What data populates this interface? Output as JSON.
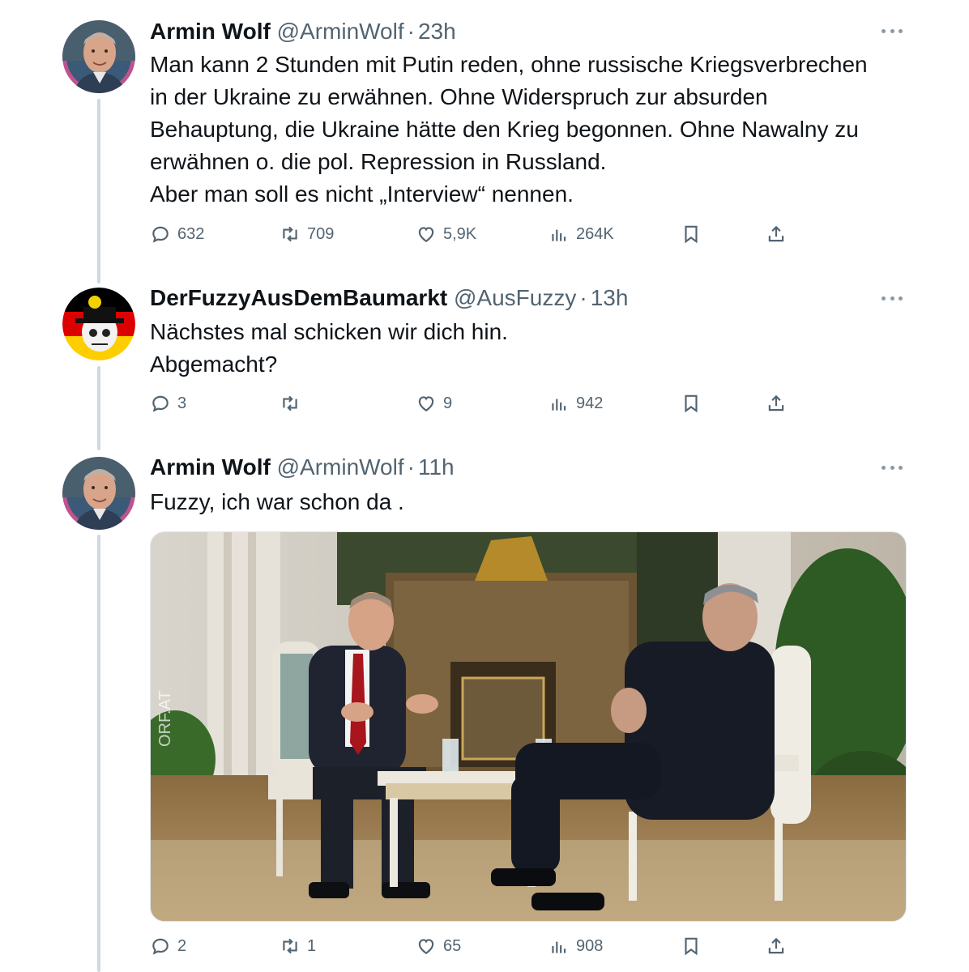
{
  "tweets": [
    {
      "name": "Armin Wolf",
      "handle": "@ArminWolf",
      "time": "23h",
      "lines": [
        "Man kann 2 Stunden mit Putin reden, ohne russische Kriegsverbrechen",
        "in der Ukraine zu erwähnen. Ohne Widerspruch zur absurden",
        "Behauptung, die Ukraine hätte den Krieg begonnen. Ohne Nawalny zu",
        "erwähnen o. die pol. Repression in Russland.",
        "Aber man soll es nicht „Interview“ nennen."
      ],
      "replies": "632",
      "retweets": "709",
      "likes": "5,9K",
      "views": "264K"
    },
    {
      "name": "DerFuzzyAusDemBaumarkt",
      "handle": "@AusFuzzy",
      "time": "13h",
      "lines": [
        "Nächstes mal schicken wir dich hin.",
        "Abgemacht?"
      ],
      "replies": "3",
      "retweets": "",
      "likes": "9",
      "views": "942"
    },
    {
      "name": "Armin Wolf",
      "handle": "@ArminWolf",
      "time": "11h",
      "lines": [
        "Fuzzy, ich war schon da ."
      ],
      "media_watermark": "ORF.AT",
      "replies": "2",
      "retweets": "1",
      "likes": "65",
      "views": "908"
    }
  ],
  "colors": {
    "text": "#0f1419",
    "secondary": "#536471",
    "thread_line": "#cfd9de"
  }
}
